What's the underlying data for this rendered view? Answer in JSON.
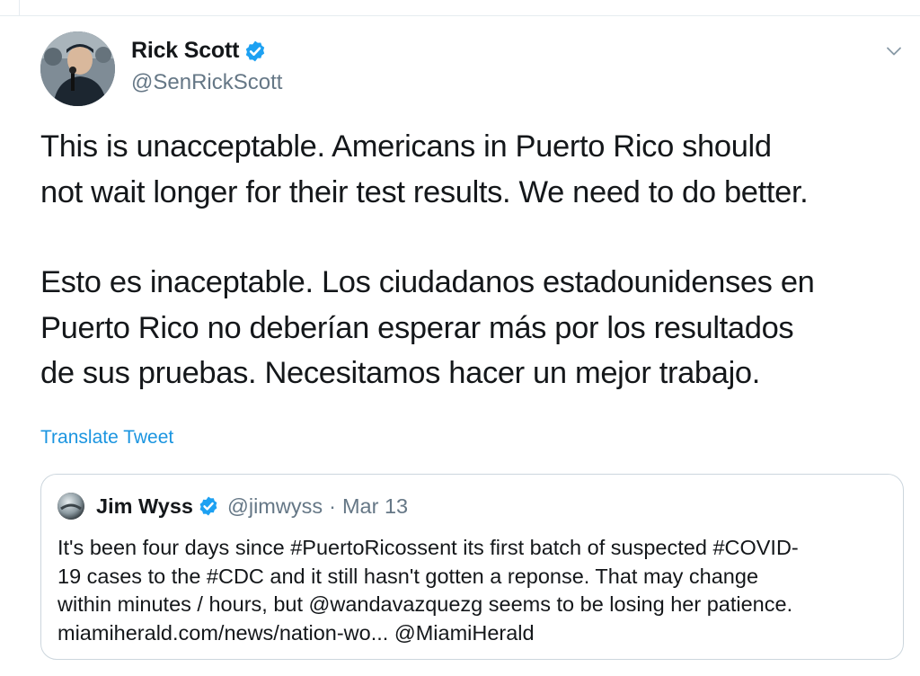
{
  "tweet": {
    "author": {
      "display_name": "Rick Scott",
      "handle": "@SenRickScott",
      "verified": true
    },
    "text_paragraphs": [
      [
        "This is unacceptable. Americans in Puerto Rico should",
        "not wait longer for their test results. We need to do better."
      ],
      [
        "Esto es inaceptable. Los ciudadanos estadounidenses en",
        "Puerto Rico no deberían esperar más por los resultados",
        "de sus pruebas. Necesitamos hacer un mejor trabajo."
      ]
    ],
    "translate_label": "Translate Tweet",
    "menu_icon": "chevron-down-icon"
  },
  "quote": {
    "author": {
      "display_name": "Jim Wyss",
      "handle": "@jimwyss",
      "verified": true
    },
    "separator": "·",
    "date": "Mar 13",
    "text_lines": [
      "It's been four days since #PuertoRicossent its first batch of suspected #COVID-",
      "19 cases to the #CDC and it still hasn't gotten a reponse. That may change",
      "within minutes / hours, but @wandavazquezg seems to be losing her patience.",
      "miamiherald.com/news/nation-wo... @MiamiHerald"
    ]
  },
  "colors": {
    "text": "#14171a",
    "secondary": "#657786",
    "link": "#1b95e0",
    "verified": "#1da1f2",
    "border": "#ccd6dd"
  }
}
